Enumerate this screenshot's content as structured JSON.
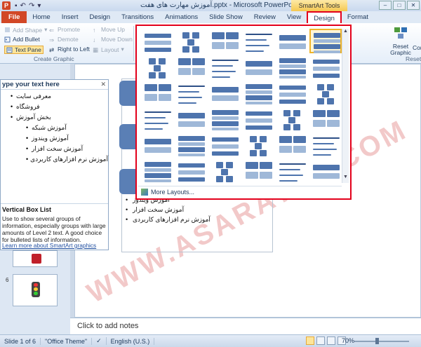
{
  "window": {
    "app_letter": "P",
    "title": "آموزش مهارت های هفت.pptx - Microsoft PowerPoint",
    "contextual_tab_group": "SmartArt Tools",
    "controls": [
      "–",
      "□",
      "✕"
    ]
  },
  "tabs": [
    {
      "label": "File"
    },
    {
      "label": "Home"
    },
    {
      "label": "Insert"
    },
    {
      "label": "Design"
    },
    {
      "label": "Transitions"
    },
    {
      "label": "Animations"
    },
    {
      "label": "Slide Show"
    },
    {
      "label": "Review"
    },
    {
      "label": "View"
    },
    {
      "label": "Design"
    },
    {
      "label": "Format"
    }
  ],
  "ribbon": {
    "add_shape": "Add Shape",
    "add_bullet": "Add Bullet",
    "text_pane": "Text Pane",
    "promote": "Promote",
    "demote": "Demote",
    "right_to_left": "Right to Left",
    "move_up": "Move Up",
    "move_down": "Move Down",
    "layout": "Layout",
    "group_label": "Create Graphic",
    "reset_graphic": "Reset Graphic",
    "reset_group": "Reset",
    "convert_partial": "Con"
  },
  "text_pane": {
    "header": "ype your text here",
    "close": "✕",
    "items": [
      {
        "text": "معرفی سایت",
        "level": 1
      },
      {
        "text": "فروشگاه",
        "level": 1
      },
      {
        "text": "بخش آموزش",
        "level": 1
      },
      {
        "text": "آموزش شبکه",
        "level": 2
      },
      {
        "text": "آموزش ویندوز",
        "level": 2
      },
      {
        "text": "آموزش سخت افزار",
        "level": 2
      },
      {
        "text": "آموزش نرم افزارهای کاربردی",
        "level": 2
      }
    ],
    "layout_name": "Vertical Box List",
    "layout_description": "Use to show several groups of information, especially groups with large amounts of Level 2 text. A good choice for bulleted lists of information.",
    "learn_more": "Learn more about SmartArt graphics"
  },
  "slides": {
    "visible_numbers": [
      "6"
    ]
  },
  "slide": {
    "bullets": [
      "آموزش ویندوز",
      "آموزش سخت افزار",
      "آموزش نرم افزارهای کاربردی"
    ],
    "watermark": "WWW.ASARAYAN.COM"
  },
  "gallery": {
    "more_layouts": "More Layouts..."
  },
  "notes": {
    "placeholder": "Click to add notes"
  },
  "statusbar": {
    "slide_info": "Slide 1 of 6",
    "theme": "\"Office Theme\"",
    "language": "English (U.S.)",
    "zoom": "70%"
  }
}
